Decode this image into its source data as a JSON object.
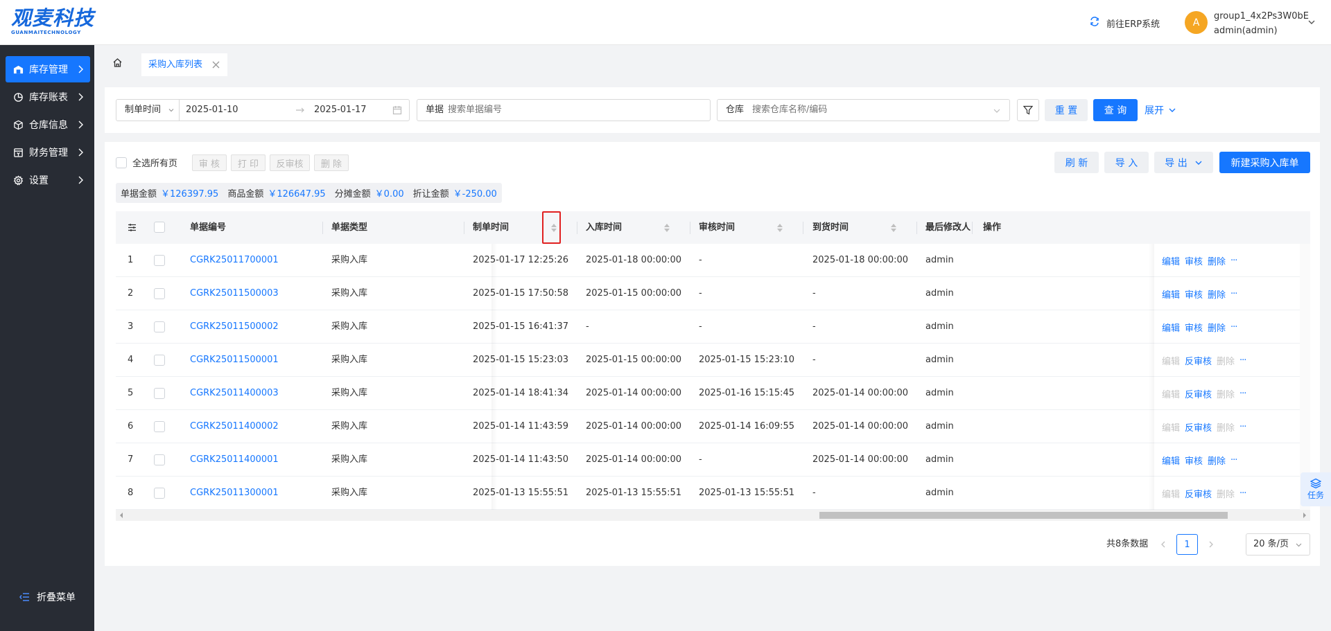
{
  "header": {
    "logo_cn": "观麦科技",
    "logo_en": "GUANMAITECHNOLOGY",
    "erp_link": "前往ERP系统",
    "avatar_letter": "A",
    "user_group": "group1_4x2Ps3W0bE",
    "user_name": "admin(admin)"
  },
  "sidebar": {
    "items": [
      {
        "label": "库存管理",
        "icon": "warehouse-icon",
        "active": true
      },
      {
        "label": "库存账表",
        "icon": "pie-chart-icon",
        "active": false
      },
      {
        "label": "仓库信息",
        "icon": "box-icon",
        "active": false
      },
      {
        "label": "财务管理",
        "icon": "finance-icon",
        "active": false
      },
      {
        "label": "设置",
        "icon": "gear-icon",
        "active": false
      }
    ],
    "collapse_label": "折叠菜单"
  },
  "tabs": {
    "current": "采购入库列表"
  },
  "filters": {
    "date_type": "制单时间",
    "date_start": "2025-01-10",
    "date_end": "2025-01-17",
    "doc_label": "单据",
    "doc_placeholder": "搜索单据编号",
    "warehouse_label": "仓库",
    "warehouse_placeholder": "搜索仓库名称/编码",
    "reset": "重 置",
    "query": "查 询",
    "expand": "展开"
  },
  "toolbar": {
    "select_all": "全选所有页",
    "audit": "审 核",
    "print": "打 印",
    "unaudit": "反审核",
    "delete": "删 除",
    "refresh": "刷 新",
    "import": "导 入",
    "export": "导 出",
    "new": "新建采购入库单"
  },
  "amounts": [
    {
      "label": "单据金额",
      "value": "￥126397.95"
    },
    {
      "label": "商品金额",
      "value": "￥126647.95"
    },
    {
      "label": "分摊金额",
      "value": "￥0.00"
    },
    {
      "label": "折让金额",
      "value": "￥-250.00"
    }
  ],
  "table": {
    "columns": [
      "单据编号",
      "单据类型",
      "制单时间",
      "入库时间",
      "审核时间",
      "到货时间",
      "最后修改人",
      "操作"
    ],
    "rows": [
      {
        "no": "1",
        "code": "CGRK25011700001",
        "type": "采购入库",
        "created": "2025-01-17 12:25:26",
        "instock": "2025-01-18 00:00:00",
        "audited": "-",
        "arrived": "2025-01-18 00:00:00",
        "modifier": "admin",
        "ops": [
          "编辑",
          "审核",
          "删除"
        ],
        "audited_state": false
      },
      {
        "no": "2",
        "code": "CGRK25011500003",
        "type": "采购入库",
        "created": "2025-01-15 17:50:58",
        "instock": "2025-01-15 00:00:00",
        "audited": "-",
        "arrived": "-",
        "modifier": "admin",
        "ops": [
          "编辑",
          "审核",
          "删除"
        ],
        "audited_state": false
      },
      {
        "no": "3",
        "code": "CGRK25011500002",
        "type": "采购入库",
        "created": "2025-01-15 16:41:37",
        "instock": "-",
        "audited": "-",
        "arrived": "-",
        "modifier": "admin",
        "ops": [
          "编辑",
          "审核",
          "删除"
        ],
        "audited_state": false
      },
      {
        "no": "4",
        "code": "CGRK25011500001",
        "type": "采购入库",
        "created": "2025-01-15 15:23:03",
        "instock": "2025-01-15 00:00:00",
        "audited": "2025-01-15 15:23:10",
        "arrived": "-",
        "modifier": "admin",
        "ops": [
          "编辑",
          "反审核",
          "删除"
        ],
        "audited_state": true
      },
      {
        "no": "5",
        "code": "CGRK25011400003",
        "type": "采购入库",
        "created": "2025-01-14 18:41:34",
        "instock": "2025-01-14 00:00:00",
        "audited": "2025-01-16 15:15:45",
        "arrived": "2025-01-14 00:00:00",
        "modifier": "admin",
        "ops": [
          "编辑",
          "反审核",
          "删除"
        ],
        "audited_state": true
      },
      {
        "no": "6",
        "code": "CGRK25011400002",
        "type": "采购入库",
        "created": "2025-01-14 11:43:59",
        "instock": "2025-01-14 00:00:00",
        "audited": "2025-01-14 16:09:55",
        "arrived": "2025-01-14 00:00:00",
        "modifier": "admin",
        "ops": [
          "编辑",
          "反审核",
          "删除"
        ],
        "audited_state": true
      },
      {
        "no": "7",
        "code": "CGRK25011400001",
        "type": "采购入库",
        "created": "2025-01-14 11:43:50",
        "instock": "2025-01-14 00:00:00",
        "audited": "-",
        "arrived": "2025-01-14 00:00:00",
        "modifier": "admin",
        "ops": [
          "编辑",
          "审核",
          "删除"
        ],
        "audited_state": false
      },
      {
        "no": "8",
        "code": "CGRK25011300001",
        "type": "采购入库",
        "created": "2025-01-13 15:55:51",
        "instock": "2025-01-13 15:55:51",
        "audited": "2025-01-13 15:55:51",
        "arrived": "-",
        "modifier": "admin",
        "ops": [
          "编辑",
          "反审核",
          "删除"
        ],
        "audited_state": true
      }
    ]
  },
  "pagination": {
    "total": "共8条数据",
    "current_page": "1",
    "page_size": "20 条/页"
  },
  "task_float": {
    "label": "任务"
  },
  "colors": {
    "primary": "#1677ff",
    "sidebar_bg": "#282c34",
    "avatar_bg": "#f5a623",
    "highlight_box": "#e02020"
  }
}
